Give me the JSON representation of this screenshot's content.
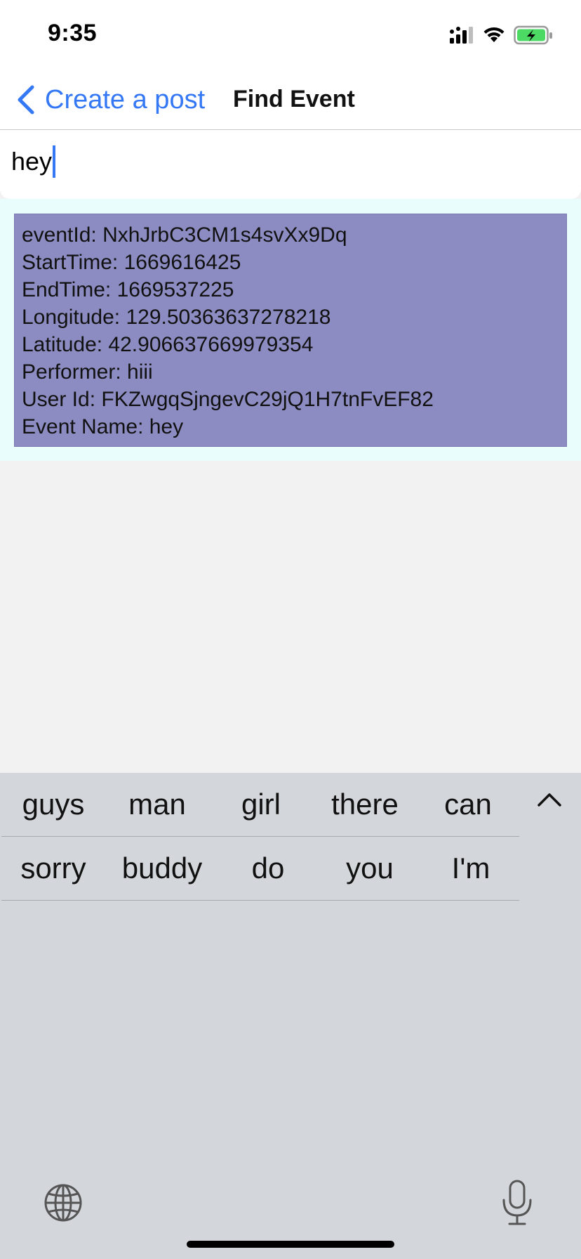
{
  "status_bar": {
    "time": "9:35",
    "icons": [
      "cellular-signal-icon",
      "wifi-icon",
      "battery-charging-icon"
    ]
  },
  "nav": {
    "back_label": "Create a post",
    "title": "Find Event",
    "back_icon": "chevron-left-icon"
  },
  "search": {
    "value": "hey"
  },
  "results": [
    {
      "lines": [
        "eventId: NxhJrbC3CM1s4svXx9Dq",
        "StartTime: 1669616425",
        "EndTime: 1669537225",
        "Longitude: 129.50363637278218",
        "Latitude: 42.906637669979354",
        "Performer: hiii",
        "User Id: FKZwgqSjngevC29jQ1H7tnFvEF82",
        "Event Name: hey"
      ]
    }
  ],
  "keyboard": {
    "suggestions_row1": [
      "guys",
      "man",
      "girl",
      "there",
      "can"
    ],
    "suggestions_row2": [
      "sorry",
      "buddy",
      "do",
      "you",
      "I'm"
    ],
    "icons": [
      "collapse-chevron-icon",
      "globe-icon",
      "microphone-icon"
    ]
  },
  "colors": {
    "accent": "#3478f6",
    "card": "#8c8cc2",
    "results_bg": "#e9fdfc",
    "keyboard_bg": "#d3d6db"
  }
}
